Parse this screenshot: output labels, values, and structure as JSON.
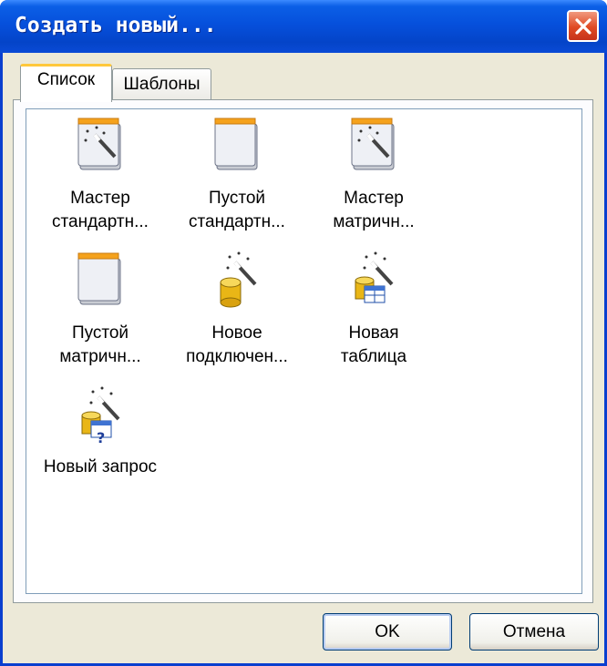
{
  "window": {
    "title": "Создать новый...",
    "close_icon": "close-icon"
  },
  "tabs": [
    {
      "label": "Список",
      "active": true
    },
    {
      "label": "Шаблоны",
      "active": false
    }
  ],
  "items": [
    {
      "label": "Мастер\nстандартн...",
      "icon": "wizard-report-icon"
    },
    {
      "label": "Пустой\nстандартн...",
      "icon": "blank-report-icon"
    },
    {
      "label": "Мастер\nматричн...",
      "icon": "wizard-report-icon"
    },
    {
      "label": "Пустой\nматричн...",
      "icon": "blank-report-icon"
    },
    {
      "label": "Новое\nподключен...",
      "icon": "new-connection-icon"
    },
    {
      "label": "Новая\nтаблица",
      "icon": "new-table-icon"
    },
    {
      "label": "Новый запрос",
      "icon": "new-query-icon"
    }
  ],
  "buttons": {
    "ok": "OK",
    "cancel": "Отмена"
  }
}
